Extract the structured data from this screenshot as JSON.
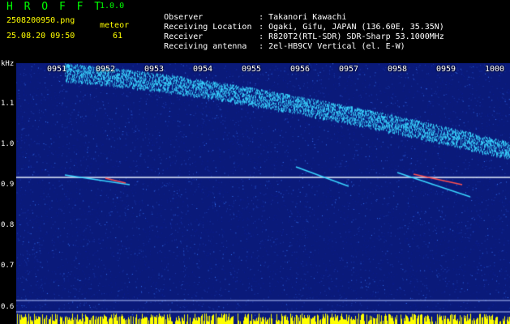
{
  "app": {
    "name": "H R O F F T",
    "version": "1.0.0"
  },
  "file": {
    "name": "2508200950.png",
    "datetime": "25.08.20 09:50"
  },
  "meteor": {
    "label": "meteor",
    "count": "61"
  },
  "info": [
    {
      "label": "Observer",
      "value": "Takanori Kawachi"
    },
    {
      "label": "Receiving Location",
      "value": "Ogaki, Gifu, JAPAN (136.60E, 35.35N)"
    },
    {
      "label": "Receiver",
      "value": "R820T2(RTL-SDR) SDR-Sharp 53.1000MHz"
    },
    {
      "label": "Receiving antenna",
      "value": "2el-HB9CV Vertical (el. E-W)"
    }
  ],
  "y_axis": {
    "unit": "kHz",
    "ticks": [
      "1.1",
      "1.0",
      "0.9",
      "0.8",
      "0.7",
      "0.6"
    ]
  },
  "x_axis": {
    "ticks": [
      "0951",
      "0952",
      "0953",
      "0954",
      "0955",
      "0956",
      "0957",
      "0958",
      "0959",
      "1000"
    ]
  },
  "colors": {
    "background": "#0a1a7a",
    "echo": "#39d5ff",
    "carrier": "#e8f0ff",
    "meteor": "#ff5050",
    "level_bar": "#ffff00"
  }
}
